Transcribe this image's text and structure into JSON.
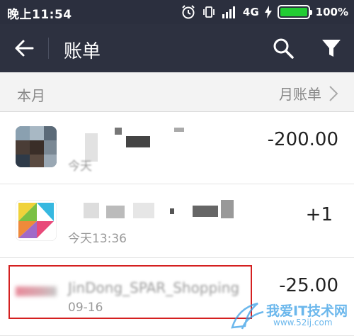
{
  "status_bar": {
    "time": "晚上11:54",
    "network": "4G",
    "battery": "100%",
    "battery_level": 1.0
  },
  "app_bar": {
    "title": "账单",
    "back_icon": "arrow-left-icon",
    "search_icon": "search-icon",
    "filter_icon": "filter-icon"
  },
  "month_section": {
    "label": "本月",
    "bill_link": "月账单"
  },
  "transactions": [
    {
      "merchant": "",
      "date": "今天",
      "amount": "-200.00"
    },
    {
      "merchant": "",
      "date": "今天13:36",
      "amount": "+1"
    },
    {
      "merchant": "JinDong_SPAR_Shopping",
      "date": "09-16",
      "amount": "-25.00"
    }
  ],
  "watermark": {
    "text": "我爱IT技术网",
    "url": "www.52ij.com"
  },
  "colors": {
    "app_bar": "#2d3140",
    "status_bar": "#2b2f3e",
    "battery_green": "#22cc33",
    "highlight_red": "#d42020"
  }
}
